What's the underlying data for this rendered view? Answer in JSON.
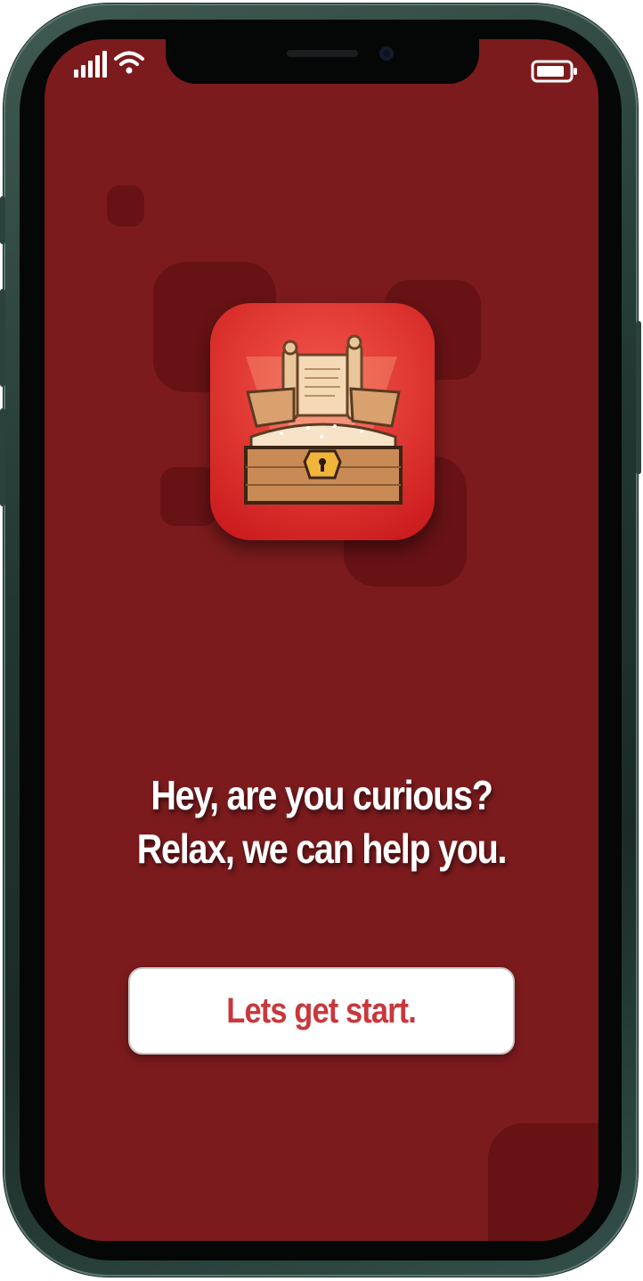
{
  "onboarding": {
    "headline_line1": "Hey, are you curious?",
    "headline_line2": "Relax, we can help you.",
    "cta_label": "Lets get start."
  },
  "icons": {
    "app_icon": "treasure-chest-scroll-icon",
    "signal": "cellular-signal-icon",
    "wifi": "wifi-icon",
    "battery": "battery-icon"
  },
  "colors": {
    "background": "#7c1b1d",
    "decor_squares": "#671215",
    "app_icon_bg": "#e13a34",
    "cta_text": "#c8383c",
    "cta_bg": "#ffffff"
  }
}
